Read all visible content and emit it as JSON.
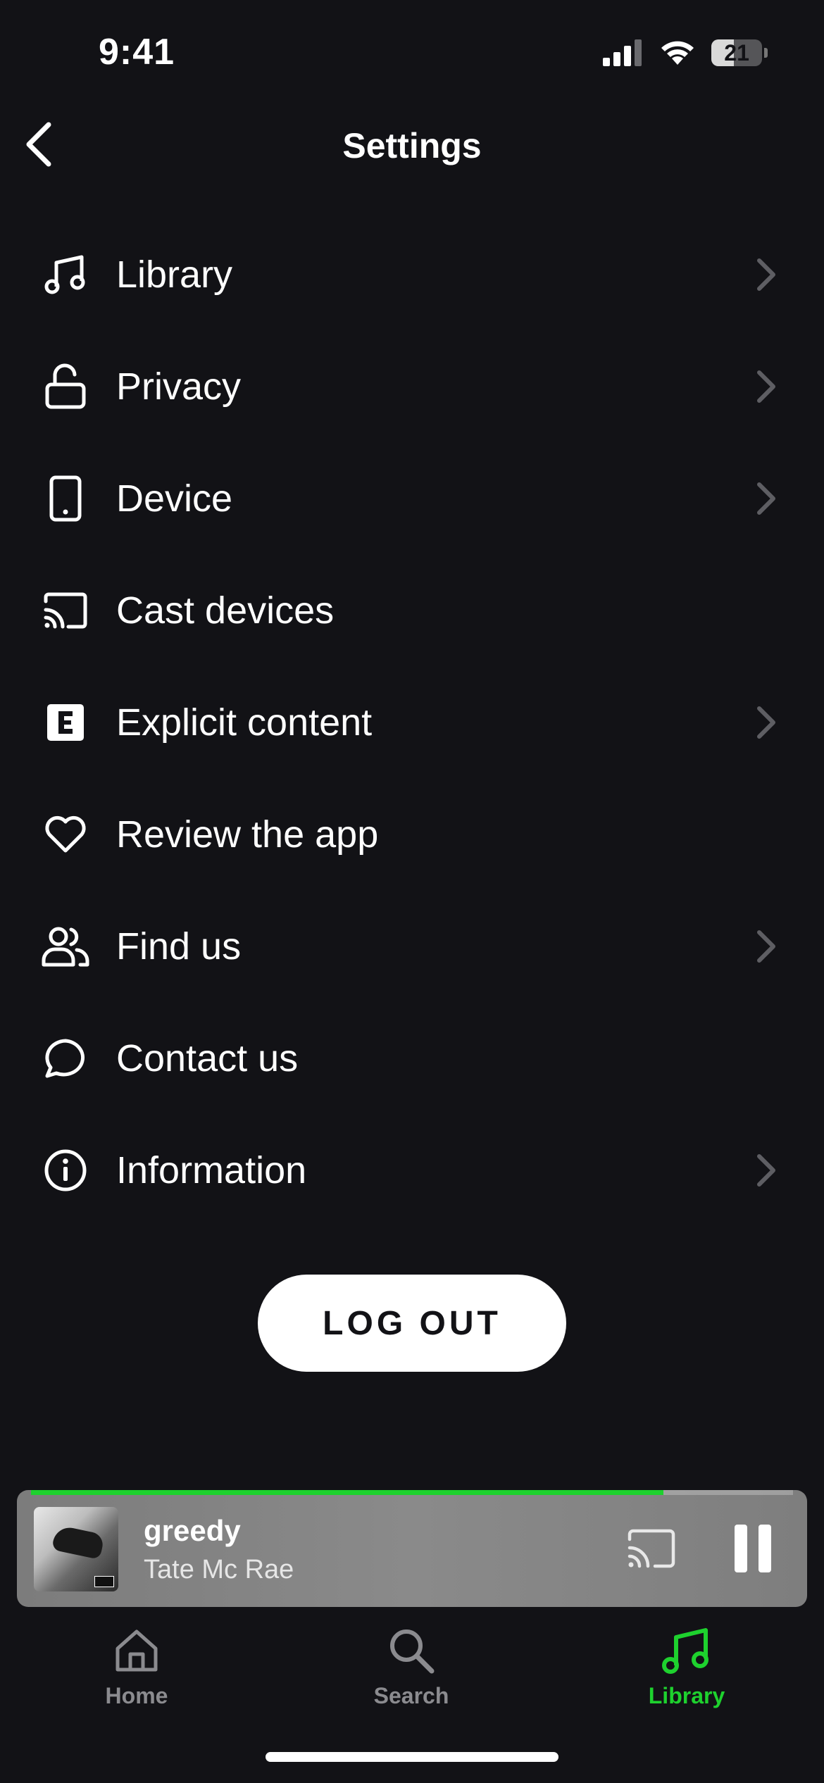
{
  "status_bar": {
    "time": "9:41",
    "battery_level": "21",
    "battery_fraction": 0.45,
    "icons": [
      "signal-icon",
      "wifi-icon",
      "battery-icon"
    ]
  },
  "header": {
    "title": "Settings",
    "back_icon": "chevron-left-icon"
  },
  "settings": {
    "items": [
      {
        "label": "Library",
        "icon": "music-note-icon",
        "has_chevron": true
      },
      {
        "label": "Privacy",
        "icon": "unlock-icon",
        "has_chevron": true
      },
      {
        "label": "Device",
        "icon": "phone-icon",
        "has_chevron": true
      },
      {
        "label": "Cast devices",
        "icon": "cast-icon",
        "has_chevron": false
      },
      {
        "label": "Explicit content",
        "icon": "explicit-icon",
        "has_chevron": true
      },
      {
        "label": "Review the app",
        "icon": "heart-icon",
        "has_chevron": false
      },
      {
        "label": "Find us",
        "icon": "users-icon",
        "has_chevron": true
      },
      {
        "label": "Contact us",
        "icon": "chat-bubble-icon",
        "has_chevron": false
      },
      {
        "label": "Information",
        "icon": "info-icon",
        "has_chevron": true
      }
    ]
  },
  "logout": {
    "label": "LOG OUT"
  },
  "player": {
    "title": "greedy",
    "artist": "Tate Mc Rae",
    "progress": 0.83,
    "progress_color": "#1ed12e"
  },
  "nav": {
    "items": [
      {
        "label": "Home",
        "icon": "home-icon",
        "active": false
      },
      {
        "label": "Search",
        "icon": "search-icon",
        "active": false
      },
      {
        "label": "Library",
        "icon": "music-note-icon",
        "active": true
      }
    ],
    "active_color": "#1ed12e",
    "inactive_color": "#8b8b8f"
  },
  "colors": {
    "background": "#121216",
    "text": "#ffffff",
    "chevron": "#5e5e63",
    "accent": "#1ed12e"
  }
}
